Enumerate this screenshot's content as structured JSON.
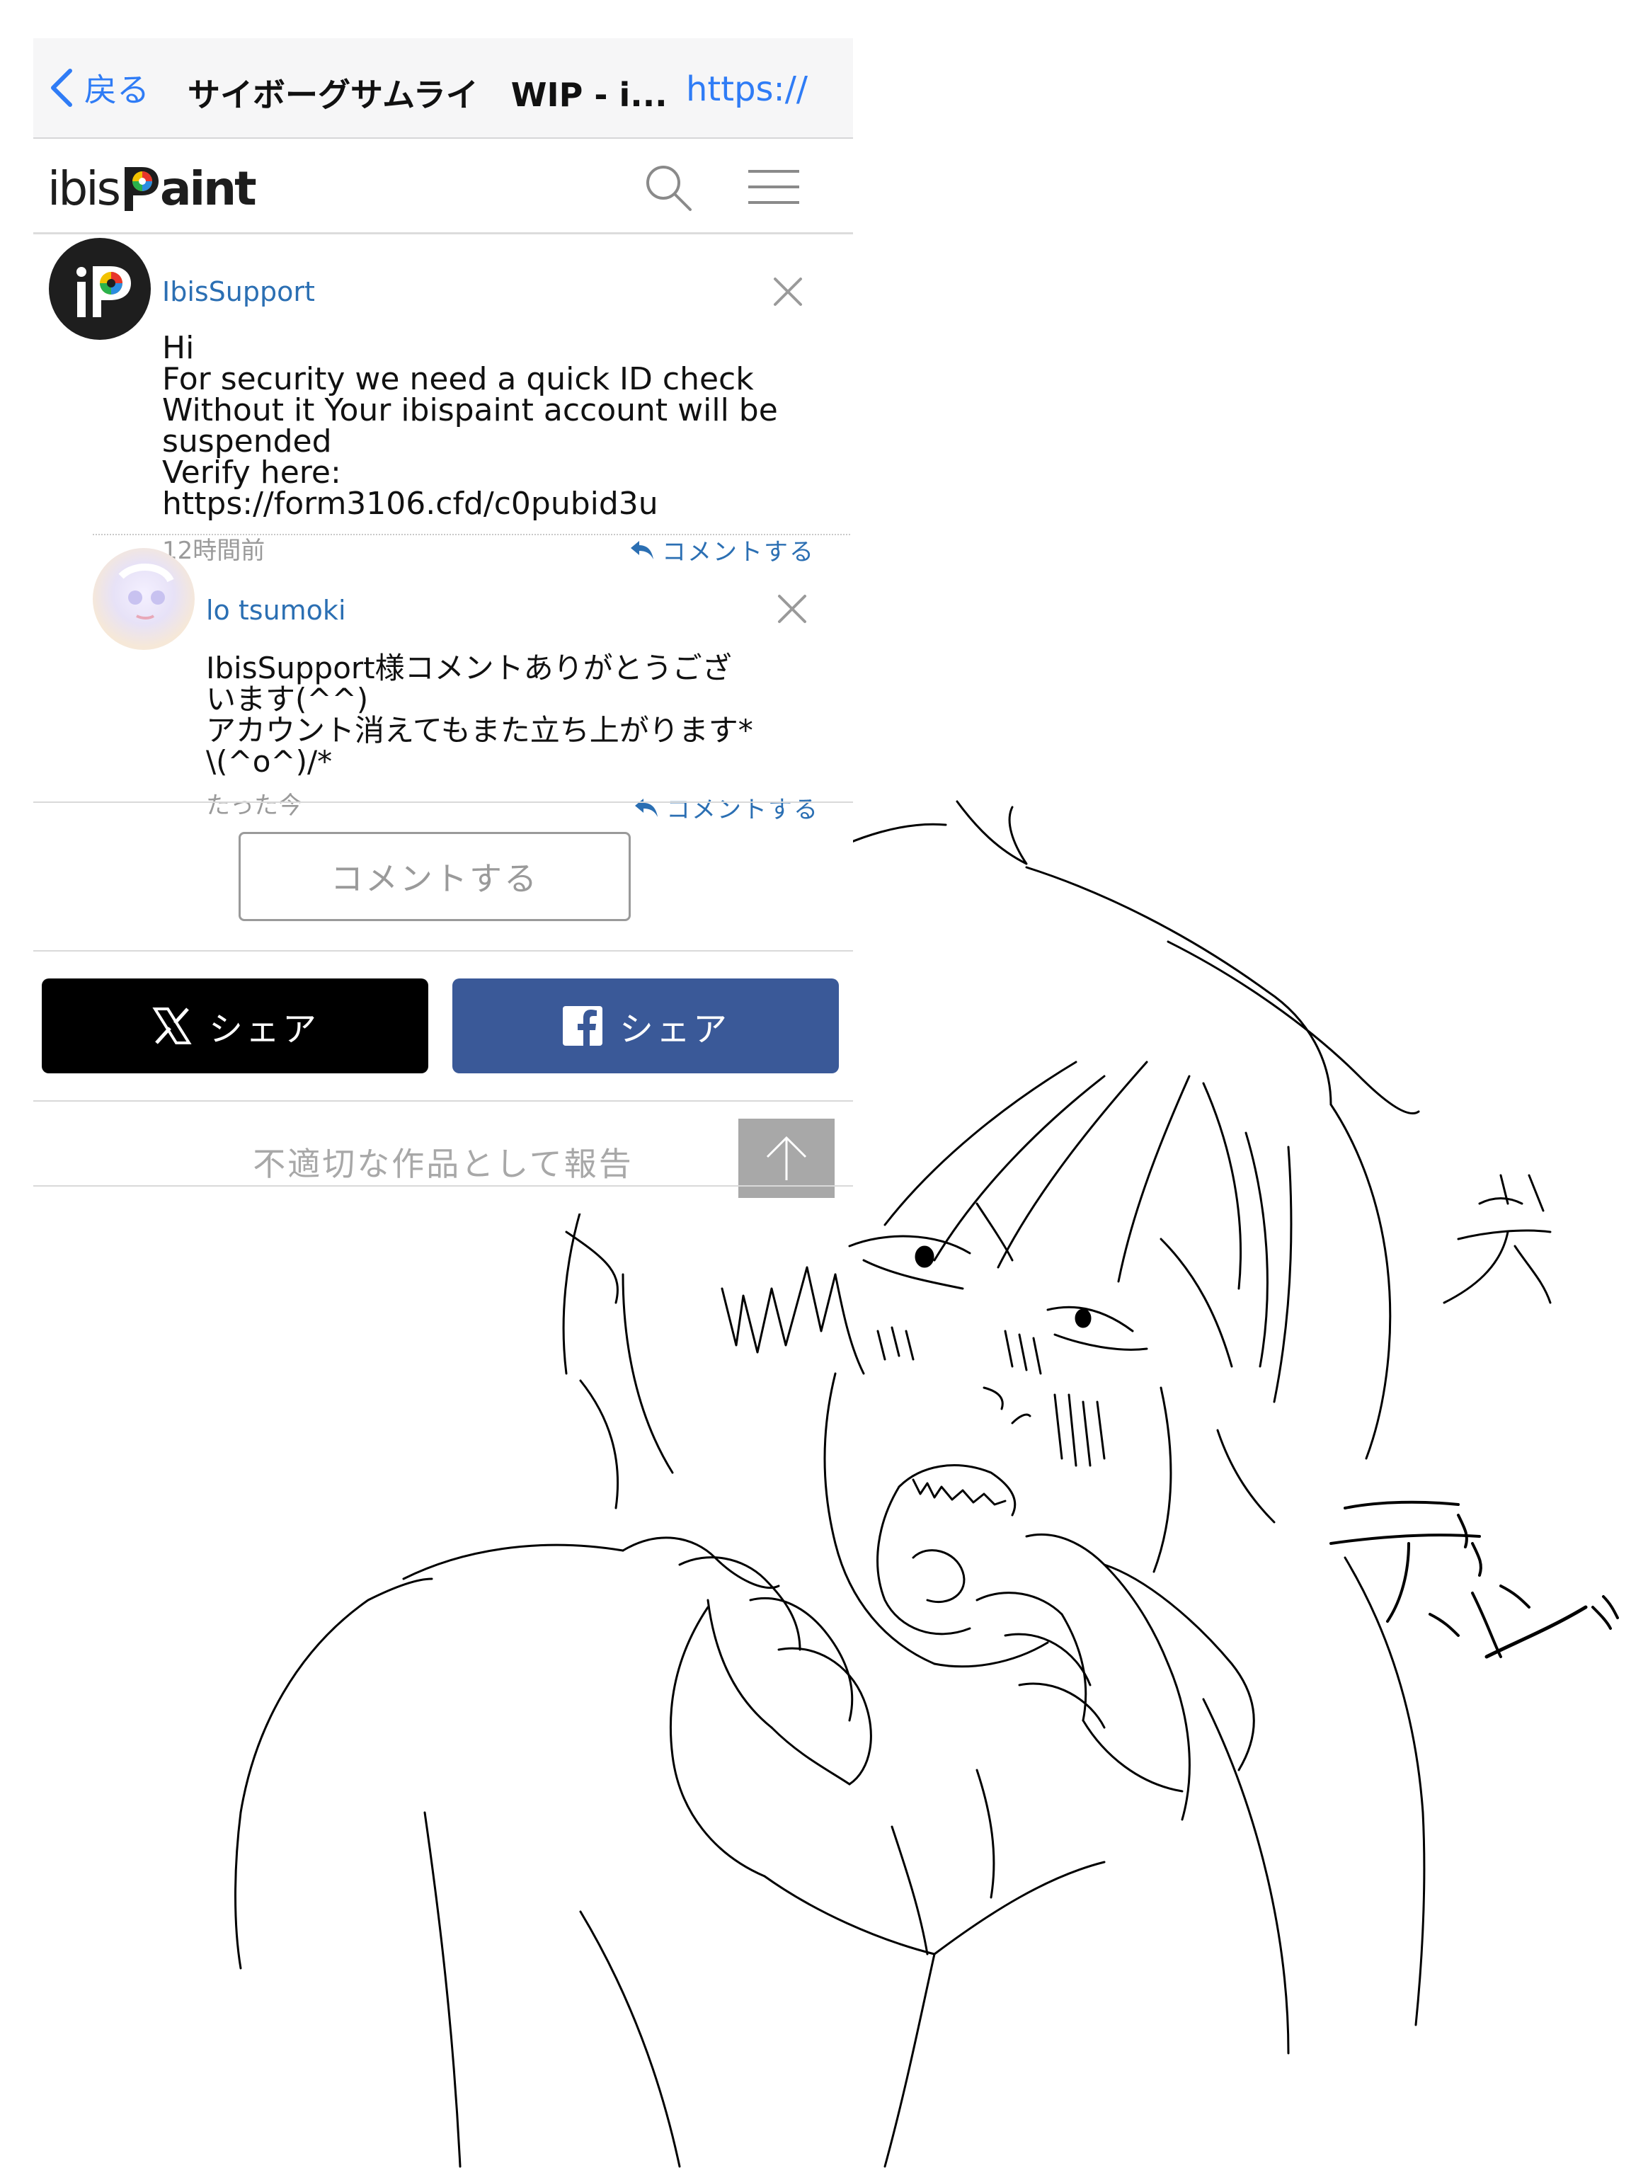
{
  "nav": {
    "back_label": "戻る",
    "title": "サイボーグサムライ　WIP - i...",
    "url": "https://"
  },
  "site": {
    "logo_regular": "ibis",
    "logo_bold": "aint"
  },
  "comments": [
    {
      "user": "IbisSupport",
      "lines": [
        "Hi",
        "For security we need a quick ID check",
        "Without it Your ibispaint account will be",
        "suspended",
        "Verify here:",
        "https://form3106.cfd/c0pubid3u"
      ],
      "time": "12時間前",
      "reply_label": "コメントする"
    },
    {
      "user": "lo tsumoki",
      "lines": [
        "IbisSupport様コメントありがとうござ",
        "います(^^)",
        "アカウント消えてもまた立ち上がります*",
        "\\(^o^)/*"
      ],
      "time": "たった今",
      "reply_label": "コメントする"
    }
  ],
  "comment_button_label": "コメントする",
  "share": {
    "x_label": "シェア",
    "facebook_label": "シェア"
  },
  "report_label": "不適切な作品として報告",
  "drawing": {
    "text_laugh": "笑",
    "sfx": "デンシ"
  },
  "colors": {
    "link": "#2f7cf6",
    "username": "#2b6fb3",
    "x_black": "#000000",
    "facebook_blue": "#3a5998",
    "gray": "#a8a8a8"
  },
  "icons": [
    "chevron-left-icon",
    "search-icon",
    "hamburger-menu-icon",
    "close-icon",
    "reply-arrow-icon",
    "x-logo-icon",
    "facebook-logo-icon",
    "arrow-up-icon"
  ]
}
